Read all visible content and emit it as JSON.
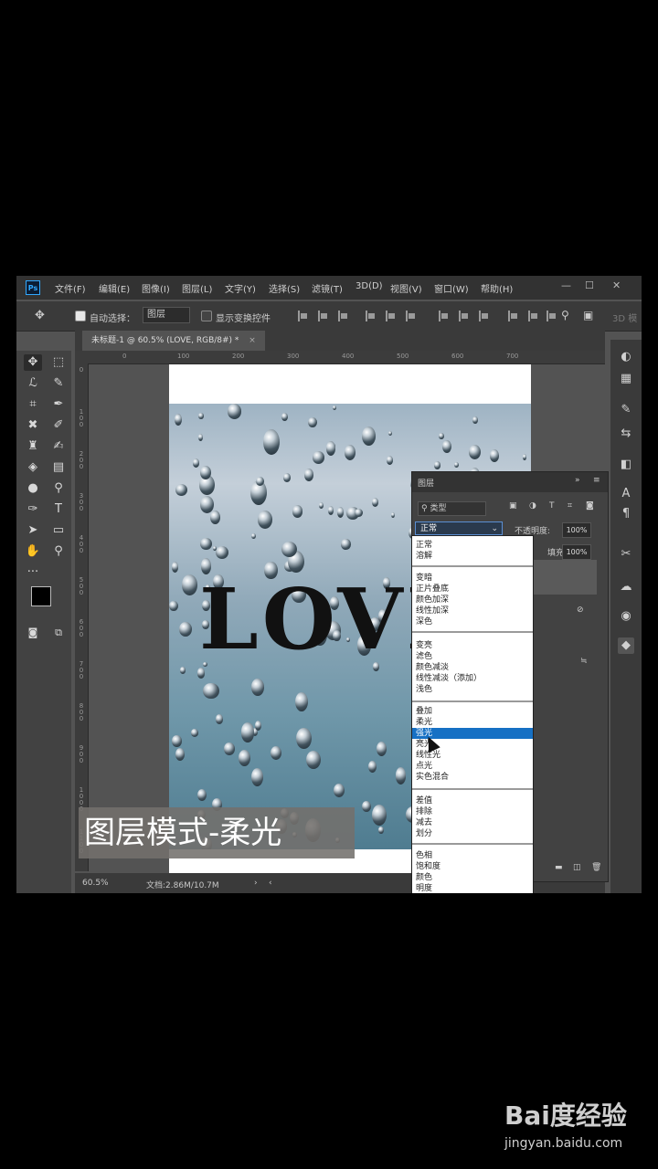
{
  "app": {
    "logo_text": "Ps",
    "menu": [
      "文件(F)",
      "编辑(E)",
      "图像(I)",
      "图层(L)",
      "文字(Y)",
      "选择(S)",
      "滤镜(T)",
      "3D(D)",
      "视图(V)",
      "窗口(W)",
      "帮助(H)"
    ],
    "window_controls": [
      "—",
      "☐",
      "✕"
    ]
  },
  "options_bar": {
    "auto_select_label": "自动选择：",
    "auto_select_target": "图层",
    "show_transform_label": "显示变换控件",
    "mode_3d_label": "3D 模"
  },
  "document": {
    "tab_title": "未标题-1 @ 60.5% (LOVE, RGB/8#) *",
    "canvas_text": "LOVE",
    "ruler_top_labels": [
      "0",
      "100",
      "200",
      "300",
      "400",
      "500",
      "600",
      "700"
    ],
    "ruler_left_labels": [
      "0",
      "1\n0\n0",
      "2\n0\n0",
      "3\n0\n0",
      "4\n0\n0",
      "5\n0\n0",
      "6\n0\n0",
      "7\n0\n0",
      "8\n0\n0",
      "9\n0\n0",
      "1\n0\n0\n0",
      "1\n1\n0\n0"
    ]
  },
  "status_bar": {
    "zoom": "60.5%",
    "doc_info": "文档:2.86M/10.7M"
  },
  "layers_panel": {
    "title": "图层",
    "filter_kind": "类型",
    "blend_mode": "正常",
    "opacity_label": "不透明度:",
    "opacity_value": "100%",
    "fill_label": "填充:",
    "fill_value": "100%"
  },
  "blend_modes": {
    "groups": [
      [
        "正常",
        "溶解"
      ],
      [
        "变暗",
        "正片叠底",
        "颜色加深",
        "线性加深",
        "深色"
      ],
      [
        "变亮",
        "滤色",
        "颜色减淡",
        "线性减淡（添加）",
        "浅色"
      ],
      [
        "叠加",
        "柔光",
        "强光",
        "亮光",
        "线性光",
        "点光",
        "实色混合"
      ],
      [
        "差值",
        "排除",
        "减去",
        "划分"
      ],
      [
        "色相",
        "饱和度",
        "颜色",
        "明度"
      ]
    ],
    "highlighted": "强光"
  },
  "caption": "图层模式-柔光",
  "watermark": {
    "logo": "Bai度经验",
    "url": "jingyan.baidu.com"
  },
  "colors": {
    "ps_bg": "#535353",
    "menu_bg": "#323232",
    "highlight": "#1670c4",
    "ps_accent": "#31a8ff"
  }
}
